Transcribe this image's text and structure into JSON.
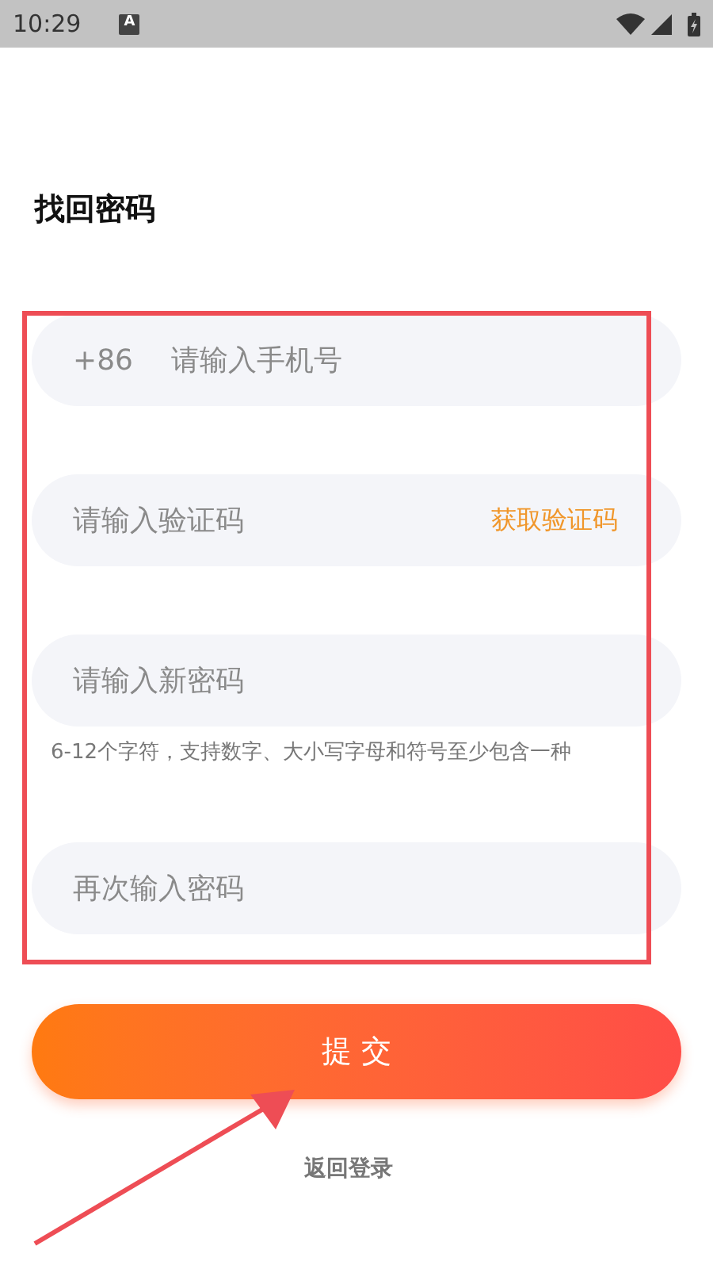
{
  "status_bar": {
    "time": "10:29",
    "notification": "A"
  },
  "title": "找回密码",
  "fields": [
    {
      "kind": "phone",
      "prefix": "+86",
      "placeholder": "请输入手机号"
    },
    {
      "kind": "code",
      "placeholder": "请输入验证码",
      "action": "获取验证码"
    },
    {
      "kind": "password",
      "placeholder": "请输入新密码",
      "hint": "6-12个字符，支持数字、大小写字母和符号至少包含一种"
    },
    {
      "kind": "password",
      "placeholder": "再次输入密码"
    }
  ],
  "submit": "提 交",
  "back_link": "返回登录"
}
